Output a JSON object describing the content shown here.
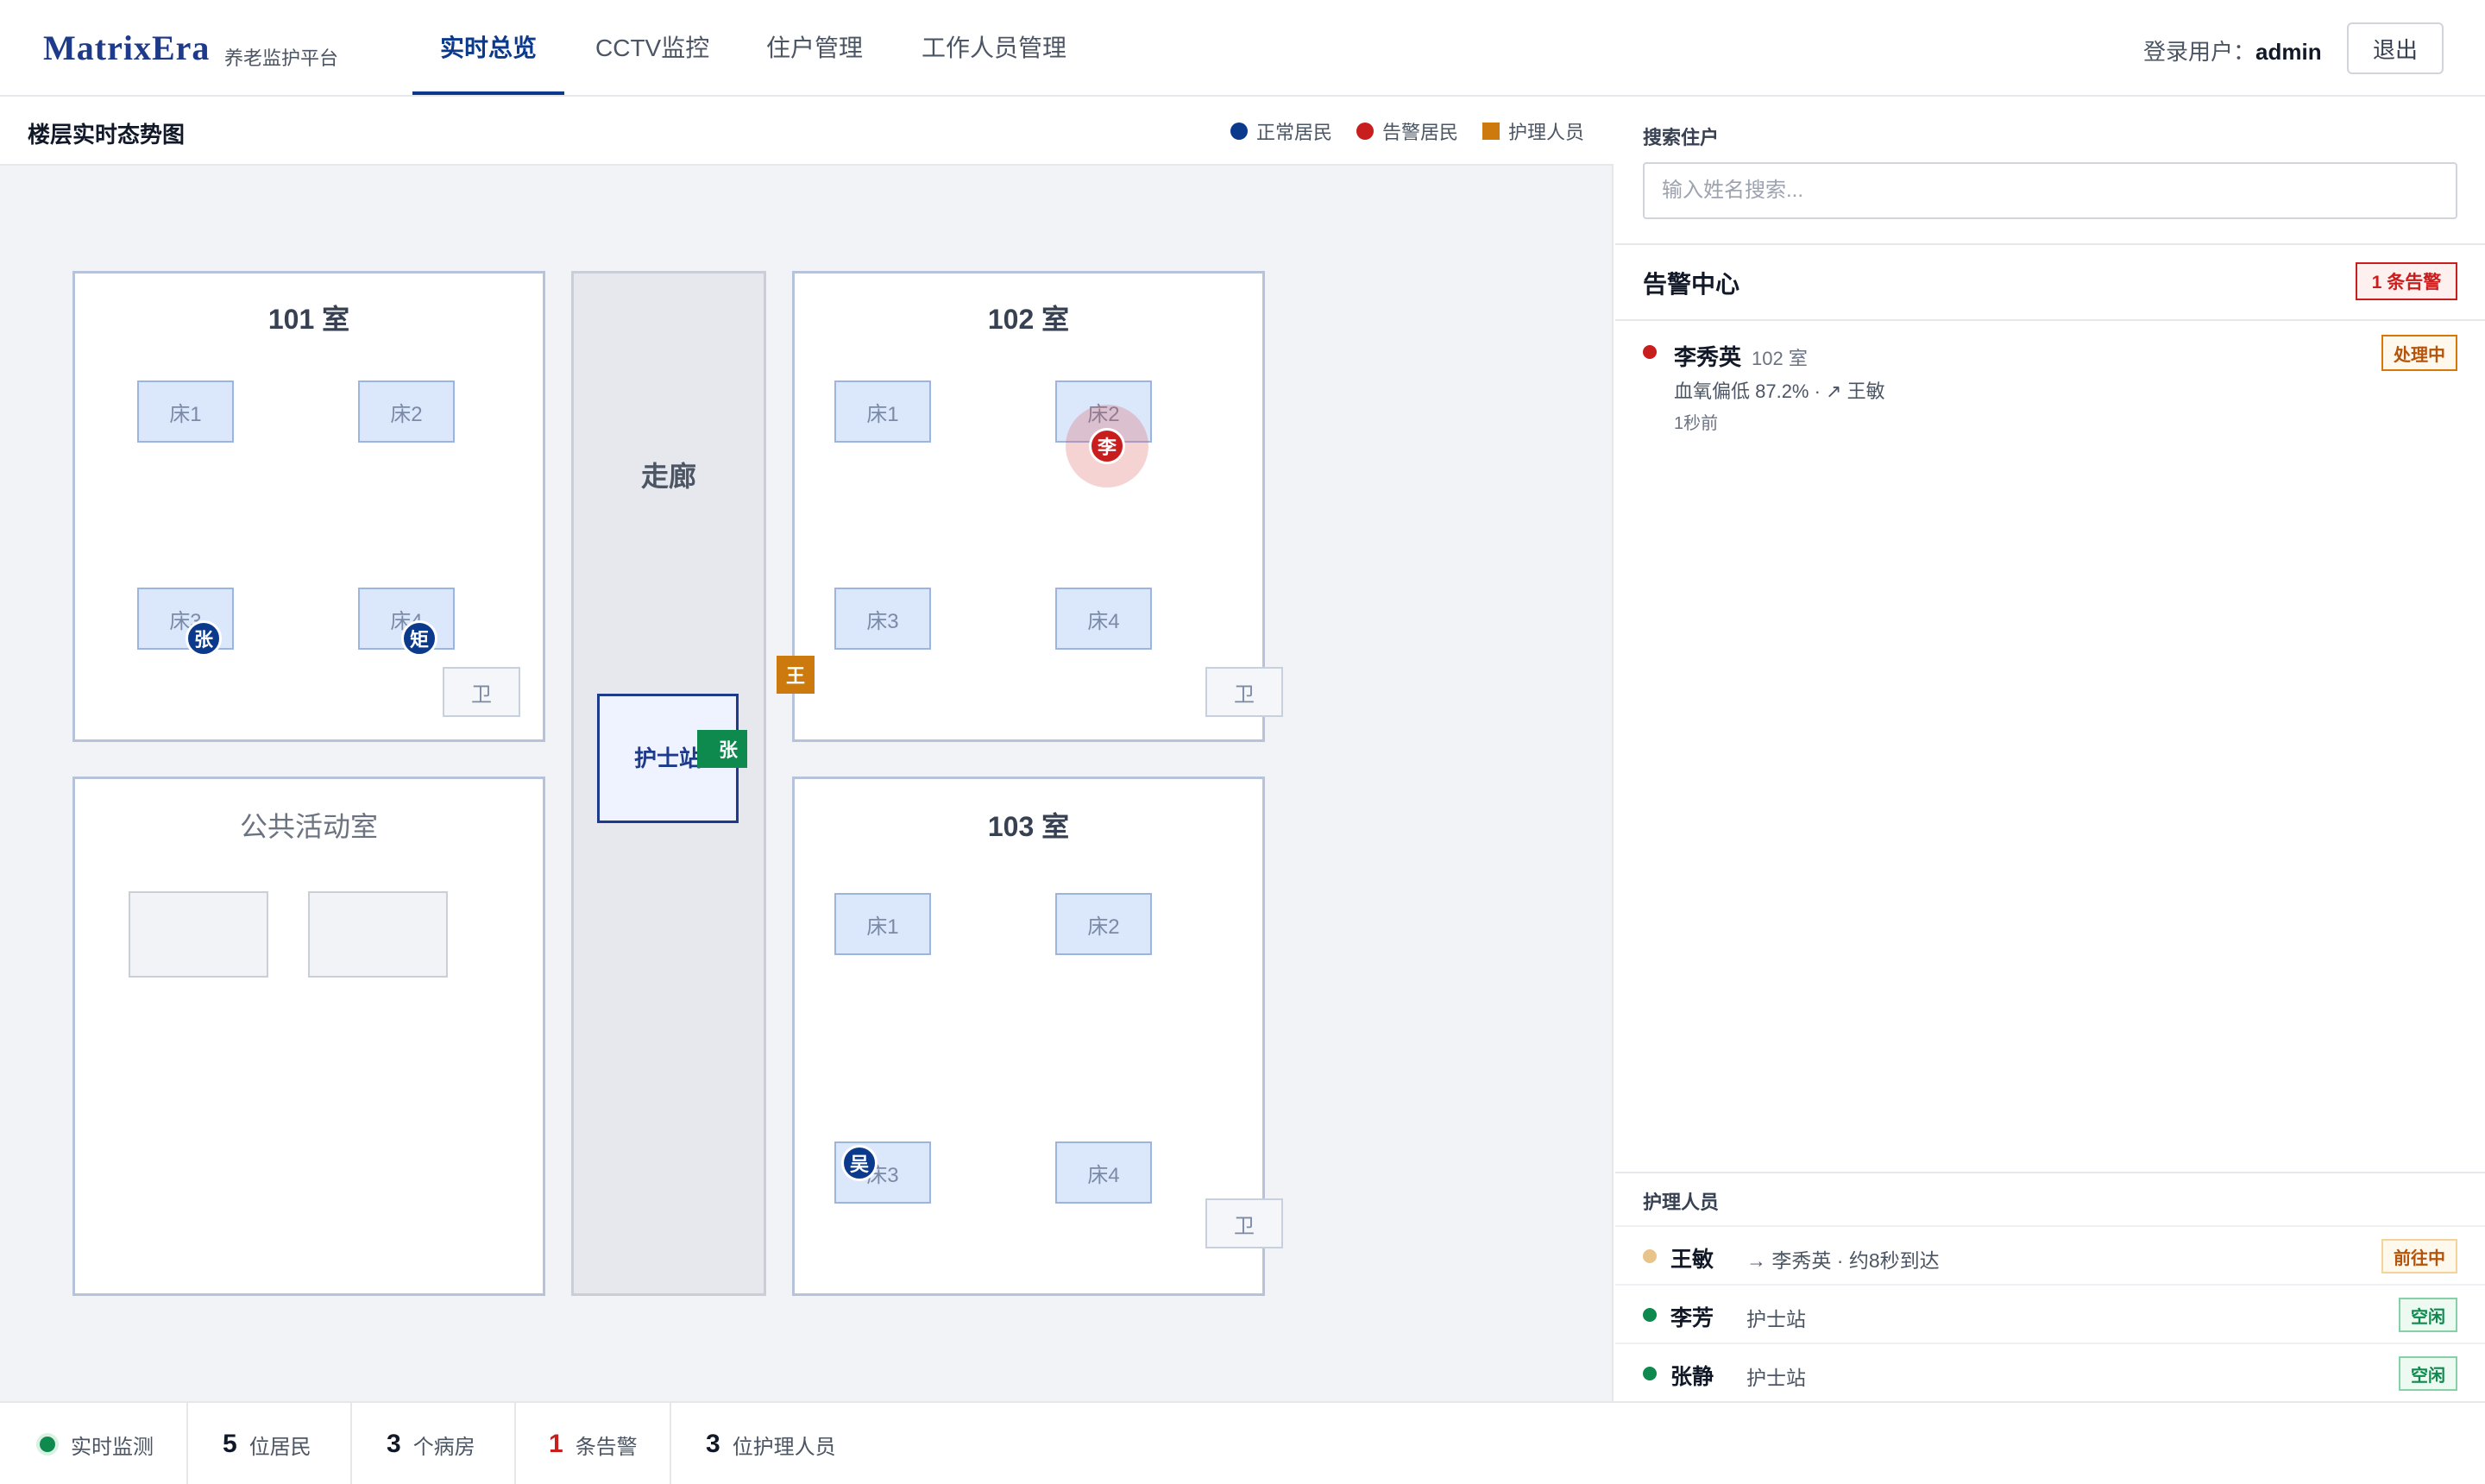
{
  "brand": {
    "name": "MatrixEra",
    "subtitle": "养老监护平台"
  },
  "nav": {
    "tabs": [
      {
        "label": "实时总览",
        "active": true
      },
      {
        "label": "CCTV监控",
        "active": false
      },
      {
        "label": "住户管理",
        "active": false
      },
      {
        "label": "工作人员管理",
        "active": false
      }
    ]
  },
  "user": {
    "prefix": "登录用户：",
    "name": "admin",
    "logout": "退出"
  },
  "map": {
    "title": "楼层实时态势图",
    "legend": {
      "normal": "正常居民",
      "alert": "告警居民",
      "staff": "护理人员"
    },
    "rooms": {
      "r101": {
        "title": "101 室",
        "beds": [
          "床1",
          "床2",
          "床3",
          "床4"
        ],
        "wc": "卫"
      },
      "r102": {
        "title": "102 室",
        "beds": [
          "床1",
          "床2",
          "床3",
          "床4"
        ],
        "wc": "卫"
      },
      "r103": {
        "title": "103 室",
        "beds": [
          "床1",
          "床2",
          "床3",
          "床4"
        ],
        "wc": "卫"
      },
      "public": {
        "title": "公共活动室"
      }
    },
    "corridor": "走廊",
    "nurse_station": "护士站",
    "residents": {
      "r101_bed3": "张",
      "r101_bed4": "矩",
      "r102_bed2": "李",
      "r103_bed3": "吴"
    },
    "staff_markers": {
      "corridor": "王",
      "station": "张"
    }
  },
  "colors": {
    "normal": "#0b3a8c",
    "alert": "#c81e1e",
    "staff": "#cc7a0e",
    "idle": "#0f8a4f"
  },
  "search": {
    "label": "搜索住户",
    "placeholder": "输入姓名搜索..."
  },
  "alerts": {
    "title": "告警中心",
    "count_badge": "1 条告警",
    "items": [
      {
        "name": "李秀英",
        "room": "102 室",
        "detail": "血氧偏低 87.2% · ↗ 王敏",
        "time": "1秒前",
        "status": "处理中"
      }
    ]
  },
  "staff": {
    "title": "护理人员",
    "items": [
      {
        "name": "王敏",
        "status": "→ 李秀英 · 约8秒到达",
        "badge": "前往中",
        "dot": "#e9c48a"
      },
      {
        "name": "李芳",
        "status": "护士站",
        "badge": "空闲",
        "dot": "#0f8a4f"
      },
      {
        "name": "张静",
        "status": "护士站",
        "badge": "空闲",
        "dot": "#0f8a4f"
      }
    ]
  },
  "footer": {
    "live": "实时监测",
    "residents": {
      "num": "5",
      "label": "位居民"
    },
    "rooms": {
      "num": "3",
      "label": "个病房"
    },
    "alerts": {
      "num": "1",
      "label": "条告警"
    },
    "staff": {
      "num": "3",
      "label": "位护理人员"
    }
  }
}
